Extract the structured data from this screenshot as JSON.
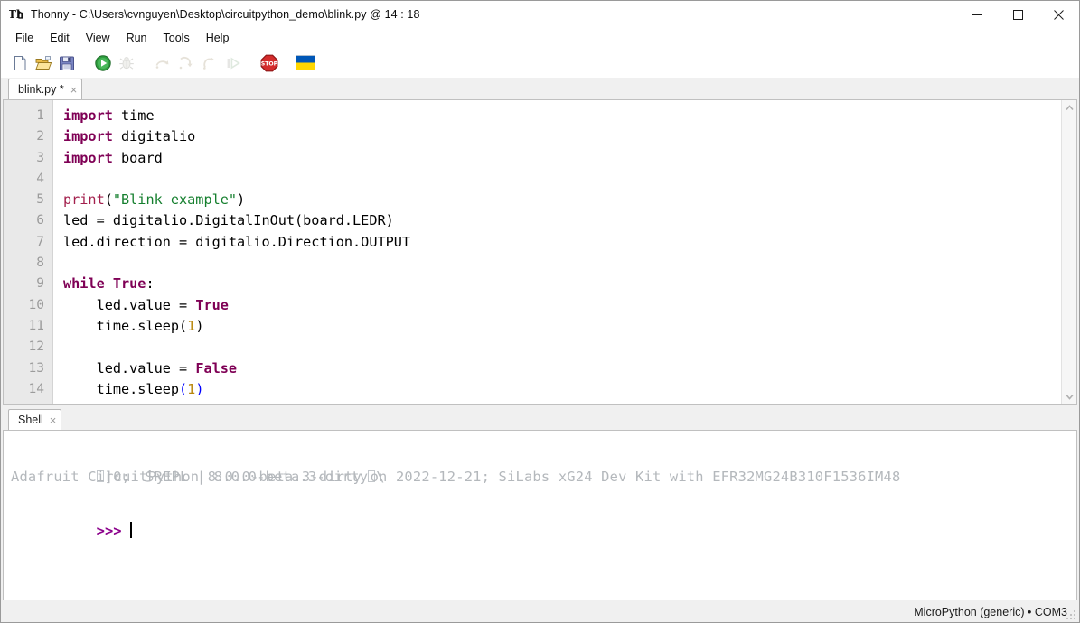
{
  "window": {
    "app_name": "Thonny",
    "title": "Thonny  -  C:\\Users\\cvnguyen\\Desktop\\circuitpython_demo\\blink.py  @  14 : 18",
    "app_icon": "thonny-icon",
    "controls": {
      "minimize": "minimize-icon",
      "maximize": "maximize-icon",
      "close": "close-icon"
    }
  },
  "menubar": {
    "items": [
      {
        "label": "File"
      },
      {
        "label": "Edit"
      },
      {
        "label": "View"
      },
      {
        "label": "Run"
      },
      {
        "label": "Tools"
      },
      {
        "label": "Help"
      }
    ]
  },
  "toolbar": {
    "buttons": [
      {
        "name": "new-file-button",
        "icon": "new-file-icon",
        "enabled": true,
        "tooltip": "New"
      },
      {
        "name": "open-file-button",
        "icon": "open-folder-icon",
        "enabled": true,
        "tooltip": "Load"
      },
      {
        "name": "save-file-button",
        "icon": "save-disk-icon",
        "enabled": true,
        "tooltip": "Save"
      },
      {
        "name": "run-button",
        "icon": "run-play-icon",
        "enabled": true,
        "tooltip": "Run current script"
      },
      {
        "name": "debug-button",
        "icon": "debug-bug-icon",
        "enabled": false,
        "tooltip": "Debug current script"
      },
      {
        "name": "step-over-button",
        "icon": "step-over-icon",
        "enabled": false,
        "tooltip": "Step over"
      },
      {
        "name": "step-into-button",
        "icon": "step-into-icon",
        "enabled": false,
        "tooltip": "Step into"
      },
      {
        "name": "step-out-button",
        "icon": "step-out-icon",
        "enabled": false,
        "tooltip": "Step out"
      },
      {
        "name": "resume-button",
        "icon": "resume-icon",
        "enabled": false,
        "tooltip": "Resume"
      },
      {
        "name": "stop-button",
        "icon": "stop-sign-icon",
        "enabled": true,
        "tooltip": "Stop/Restart backend"
      },
      {
        "name": "ukraine-flag-button",
        "icon": "ukraine-flag-icon",
        "enabled": true,
        "tooltip": "Support Ukraine"
      }
    ]
  },
  "editor": {
    "tab": {
      "label": "blink.py *",
      "close_glyph": "×"
    },
    "lines": [
      {
        "num": "1",
        "tokens": [
          {
            "t": "import",
            "c": "kw"
          },
          {
            "t": " time",
            "c": "plain"
          }
        ]
      },
      {
        "num": "2",
        "tokens": [
          {
            "t": "import",
            "c": "kw"
          },
          {
            "t": " digitalio",
            "c": "plain"
          }
        ]
      },
      {
        "num": "3",
        "tokens": [
          {
            "t": "import",
            "c": "kw"
          },
          {
            "t": " board",
            "c": "plain"
          }
        ]
      },
      {
        "num": "4",
        "tokens": []
      },
      {
        "num": "5",
        "tokens": [
          {
            "t": "print",
            "c": "fn"
          },
          {
            "t": "(",
            "c": "plain"
          },
          {
            "t": "\"Blink example\"",
            "c": "str"
          },
          {
            "t": ")",
            "c": "plain"
          }
        ]
      },
      {
        "num": "6",
        "tokens": [
          {
            "t": "led = digitalio.DigitalInOut(board.LEDR)",
            "c": "plain"
          }
        ]
      },
      {
        "num": "7",
        "tokens": [
          {
            "t": "led.direction = digitalio.Direction.OUTPUT",
            "c": "plain"
          }
        ]
      },
      {
        "num": "8",
        "tokens": []
      },
      {
        "num": "9",
        "tokens": [
          {
            "t": "while",
            "c": "kw"
          },
          {
            "t": " ",
            "c": "plain"
          },
          {
            "t": "True",
            "c": "builtin"
          },
          {
            "t": ":",
            "c": "plain"
          }
        ]
      },
      {
        "num": "10",
        "tokens": [
          {
            "t": "    led.value = ",
            "c": "plain"
          },
          {
            "t": "True",
            "c": "builtin"
          }
        ]
      },
      {
        "num": "11",
        "tokens": [
          {
            "t": "    time.sleep(",
            "c": "plain"
          },
          {
            "t": "1",
            "c": "num"
          },
          {
            "t": ")",
            "c": "plain"
          }
        ]
      },
      {
        "num": "12",
        "tokens": []
      },
      {
        "num": "13",
        "tokens": [
          {
            "t": "    led.value = ",
            "c": "plain"
          },
          {
            "t": "False",
            "c": "builtin"
          }
        ]
      },
      {
        "num": "14",
        "tokens": [
          {
            "t": "    time.sleep",
            "c": "plain"
          },
          {
            "t": "(",
            "c": "paren-hl"
          },
          {
            "t": "1",
            "c": "num"
          },
          {
            "t": ")",
            "c": "paren-hl"
          }
        ]
      }
    ],
    "scrollbar": {
      "up_arrow": "chevron-up-icon",
      "down_arrow": "chevron-down-icon"
    }
  },
  "shell": {
    "tab": {
      "label": "Shell",
      "close_glyph": "×"
    },
    "lines": [
      {
        "type": "banner-esc",
        "pre": "]0; ",
        "icon": "snake-icon",
        "post": "REPL | 8.0.0-beta.3-dirty",
        "tail": "\\"
      },
      {
        "type": "output",
        "text": "Adafruit CircuitPython 8.0.0-beta.3-dirty on 2022-12-21; SiLabs xG24 Dev Kit with EFR32MG24B310F1536IM48"
      },
      {
        "type": "prompt",
        "prompt": ">>>",
        "input": ""
      }
    ]
  },
  "statusbar": {
    "interpreter": "MicroPython (generic)",
    "separator": "•",
    "port": "COM3"
  },
  "colors": {
    "keyword": "#7f0055",
    "string": "#157f2e",
    "function": "#a3204d",
    "number": "#b8860b",
    "bracket_match": "#0000ff",
    "prompt": "#8b008b",
    "shell_output": "#b4b8bc",
    "gutter_bg": "#e9e9e9",
    "gutter_fg": "#9b9b9b",
    "chrome_bg": "#f0f0f0",
    "accent_run": "#1f9b30",
    "accent_stop": "#d32f2f",
    "ukraine_blue": "#0057b7",
    "ukraine_yellow": "#ffd700"
  }
}
